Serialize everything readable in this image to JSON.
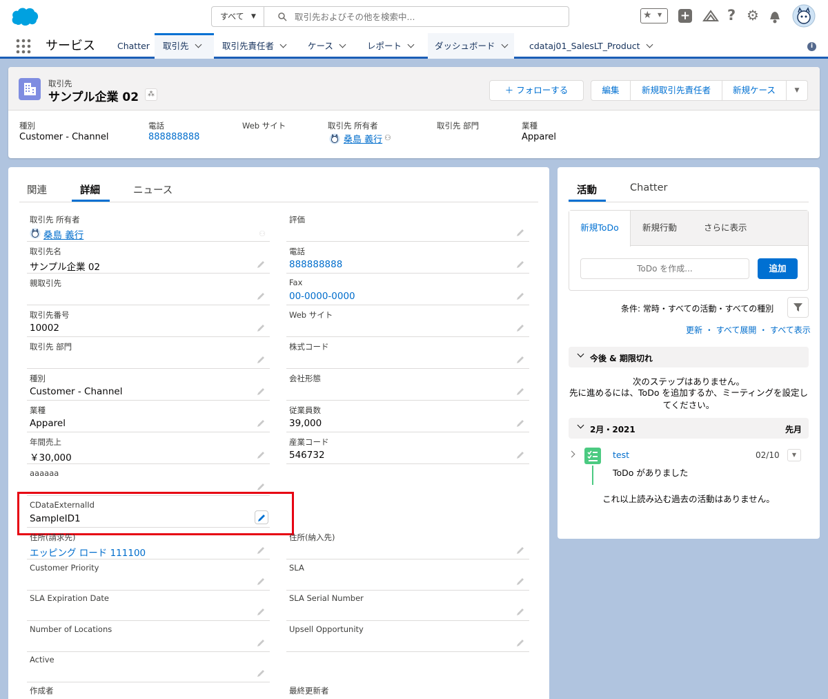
{
  "header": {
    "search_scope": "すべて",
    "search_placeholder": "取引先およびその他を検索中..."
  },
  "nav": {
    "app_name": "サービス",
    "items": [
      {
        "label": "Chatter",
        "dropdown": false
      },
      {
        "label": "取引先",
        "dropdown": true,
        "active": true
      },
      {
        "label": "取引先責任者",
        "dropdown": true
      },
      {
        "label": "ケース",
        "dropdown": true
      },
      {
        "label": "レポート",
        "dropdown": true
      },
      {
        "label": "ダッシュボード",
        "dropdown": true
      },
      {
        "label": "cdataj01_SalesLT_Product",
        "dropdown": true
      }
    ]
  },
  "record": {
    "object_label": "取引先",
    "name": "サンプル企業 02",
    "follow_button": "＋ フォローする",
    "actions": [
      "編集",
      "新規取引先責任者",
      "新規ケース"
    ],
    "highlights": [
      {
        "label": "種別",
        "value": "Customer - Channel",
        "link": false
      },
      {
        "label": "電話",
        "value": "888888888",
        "link": true
      },
      {
        "label": "Web サイト",
        "value": "",
        "link": false
      },
      {
        "label": "取引先 所有者",
        "value": "桑島 義行",
        "link": true
      },
      {
        "label": "取引先 部門",
        "value": "",
        "link": false
      },
      {
        "label": "業種",
        "value": "Apparel",
        "link": false
      }
    ]
  },
  "tabs": [
    "関連",
    "詳細",
    "ニュース"
  ],
  "details": {
    "left": [
      {
        "label": "取引先 所有者",
        "value": "桑島 義行",
        "link": true
      },
      {
        "label": "取引先名",
        "value": "サンプル企業 02"
      },
      {
        "label": "親取引先",
        "value": ""
      },
      {
        "label": "取引先番号",
        "value": "10002"
      },
      {
        "label": "取引先 部門",
        "value": ""
      },
      {
        "label": "種別",
        "value": "Customer - Channel"
      },
      {
        "label": "業種",
        "value": "Apparel"
      },
      {
        "label": "年間売上",
        "value": "￥30,000"
      },
      {
        "label": "aaaaaa",
        "value": ""
      },
      {
        "label": "CDataExternalId",
        "value": "SampleID1"
      },
      {
        "label": "住所(請求先)",
        "value": "エッピング ロード 111100",
        "link": true
      },
      {
        "label": "Customer Priority",
        "value": ""
      },
      {
        "label": "SLA Expiration Date",
        "value": ""
      },
      {
        "label": "Number of Locations",
        "value": ""
      },
      {
        "label": "Active",
        "value": ""
      },
      {
        "label": "作成者",
        "value": ""
      }
    ],
    "right": [
      {
        "label": "評価",
        "value": ""
      },
      {
        "label": "電話",
        "value": "888888888",
        "link": true
      },
      {
        "label": "Fax",
        "value": "00-0000-0000",
        "link": true
      },
      {
        "label": "Web サイト",
        "value": ""
      },
      {
        "label": "株式コード",
        "value": ""
      },
      {
        "label": "会社形態",
        "value": ""
      },
      {
        "label": "従業員数",
        "value": "39,000"
      },
      {
        "label": "産業コード",
        "value": "546732"
      },
      {
        "label": "住所(納入先)",
        "value": ""
      },
      {
        "label": "SLA",
        "value": ""
      },
      {
        "label": "SLA Serial Number",
        "value": ""
      },
      {
        "label": "Upsell Opportunity",
        "value": ""
      },
      {
        "label": "最終更新者",
        "value": ""
      }
    ]
  },
  "activity": {
    "tabs": [
      "活動",
      "Chatter"
    ],
    "subtabs": [
      "新規ToDo",
      "新規行動",
      "さらに表示"
    ],
    "todo_placeholder": "ToDo を作成...",
    "add_button": "追加",
    "filter_text": "条件: 常時・すべての活動・すべての種別",
    "links": [
      "更新",
      "すべて展開",
      "すべて表示"
    ],
    "section_upcoming": "今後 & 期限切れ",
    "no_steps": "次のステップはありません。",
    "no_steps_hint": "先に進めるには、ToDo を追加するか、ミーティングを設定し\nてください。",
    "month": "2月・2021",
    "month_tag": "先月",
    "item_title": "test",
    "item_date": "02/10",
    "item_desc": "ToDo がありました",
    "no_more": "これ以上読み込む過去の活動はありません。"
  },
  "colors": {
    "brand": "#0070d2",
    "highlight": "#e60012",
    "todo": "#4bca81",
    "account": "#7f8de1"
  }
}
